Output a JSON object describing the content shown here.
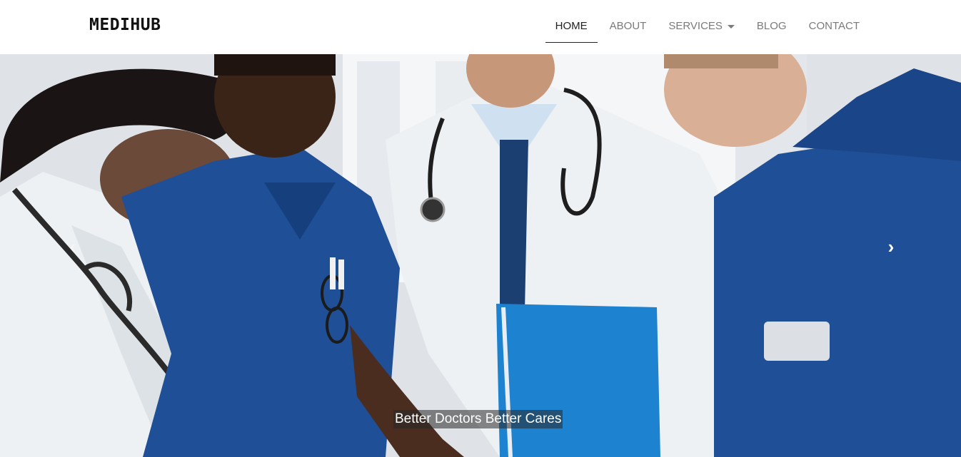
{
  "brand": {
    "name": "MEDIHUB"
  },
  "nav": {
    "items": [
      {
        "label": "HOME",
        "active": true
      },
      {
        "label": "ABOUT"
      },
      {
        "label": "SERVICES",
        "dropdown": true
      },
      {
        "label": "BLOG"
      },
      {
        "label": "CONTACT"
      }
    ]
  },
  "carousel": {
    "caption": "Better Doctors Better Cares",
    "prev_icon": "chevron-left-icon",
    "next_icon": "chevron-right-icon",
    "prev_glyph": "‹",
    "next_glyph": "›"
  },
  "colors": {
    "scrubs_blue": "#1f4f97",
    "coat_white": "#eef1f4",
    "folder_blue": "#1d82cf"
  }
}
